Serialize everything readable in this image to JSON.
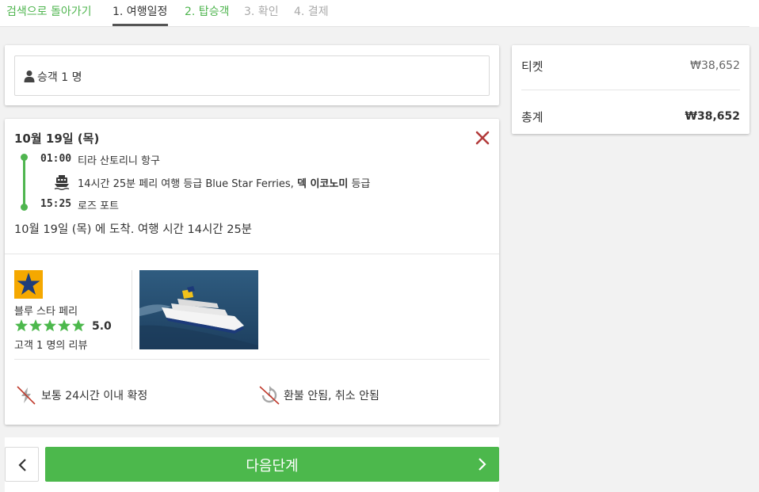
{
  "nav": {
    "back_label": "검색으로 돌아가기",
    "steps": [
      "1. 여행일정",
      "2. 탑승객",
      "3. 확인",
      "4. 결제"
    ]
  },
  "passenger": {
    "label": "승객 1 명"
  },
  "trip": {
    "date": "10월 19일 (목)",
    "depart_time": "01:00",
    "depart_place": "티라 산토리니 항구",
    "leg_prefix": "14시간 25분 페리 여행 등급 Blue Star Ferries,",
    "leg_class": "덱 이코노미",
    "leg_suffix": "등급",
    "arrive_time": "15:25",
    "arrive_place": "로즈 포트",
    "arrival_text": "10월 19일 (목) 에 도착. 여행 시간 14시간 25분"
  },
  "operator": {
    "name": "블루 스타 페리",
    "rating": "5.0",
    "rating_value": 5,
    "reviews": "고객 1 명의 리뷰"
  },
  "features": {
    "confirm": "보통 24시간 이내 확정",
    "refund": "환불 안됨, 취소 안됨"
  },
  "buttons": {
    "next_label": "다음단계"
  },
  "summary": {
    "ticket_label": "티켓",
    "ticket_amount": "₩38,652",
    "total_label": "총계",
    "total_amount": "₩38,652"
  },
  "colors": {
    "accent": "#4cb84c",
    "close": "#b23b3b",
    "logo": "#f5a800"
  }
}
